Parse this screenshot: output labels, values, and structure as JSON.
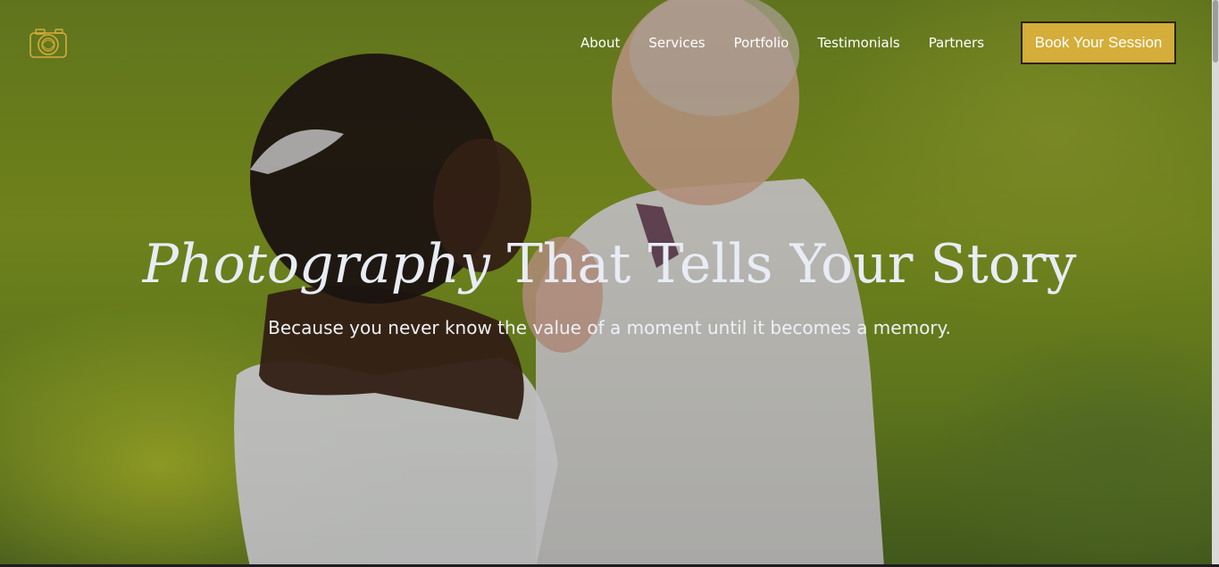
{
  "nav": {
    "items": [
      "About",
      "Services",
      "Portfolio",
      "Testimonials",
      "Partners"
    ],
    "cta_label": "Book Your Session"
  },
  "hero": {
    "headline_emphasis": "Photography",
    "headline_rest": " That Tells Your Story",
    "subheadline": "Because you never know the value of a moment until it becomes a memory."
  },
  "icons": {
    "logo": "camera-icon"
  },
  "colors": {
    "accent": "#d4ad3a",
    "text_light": "#e8ecf5"
  }
}
